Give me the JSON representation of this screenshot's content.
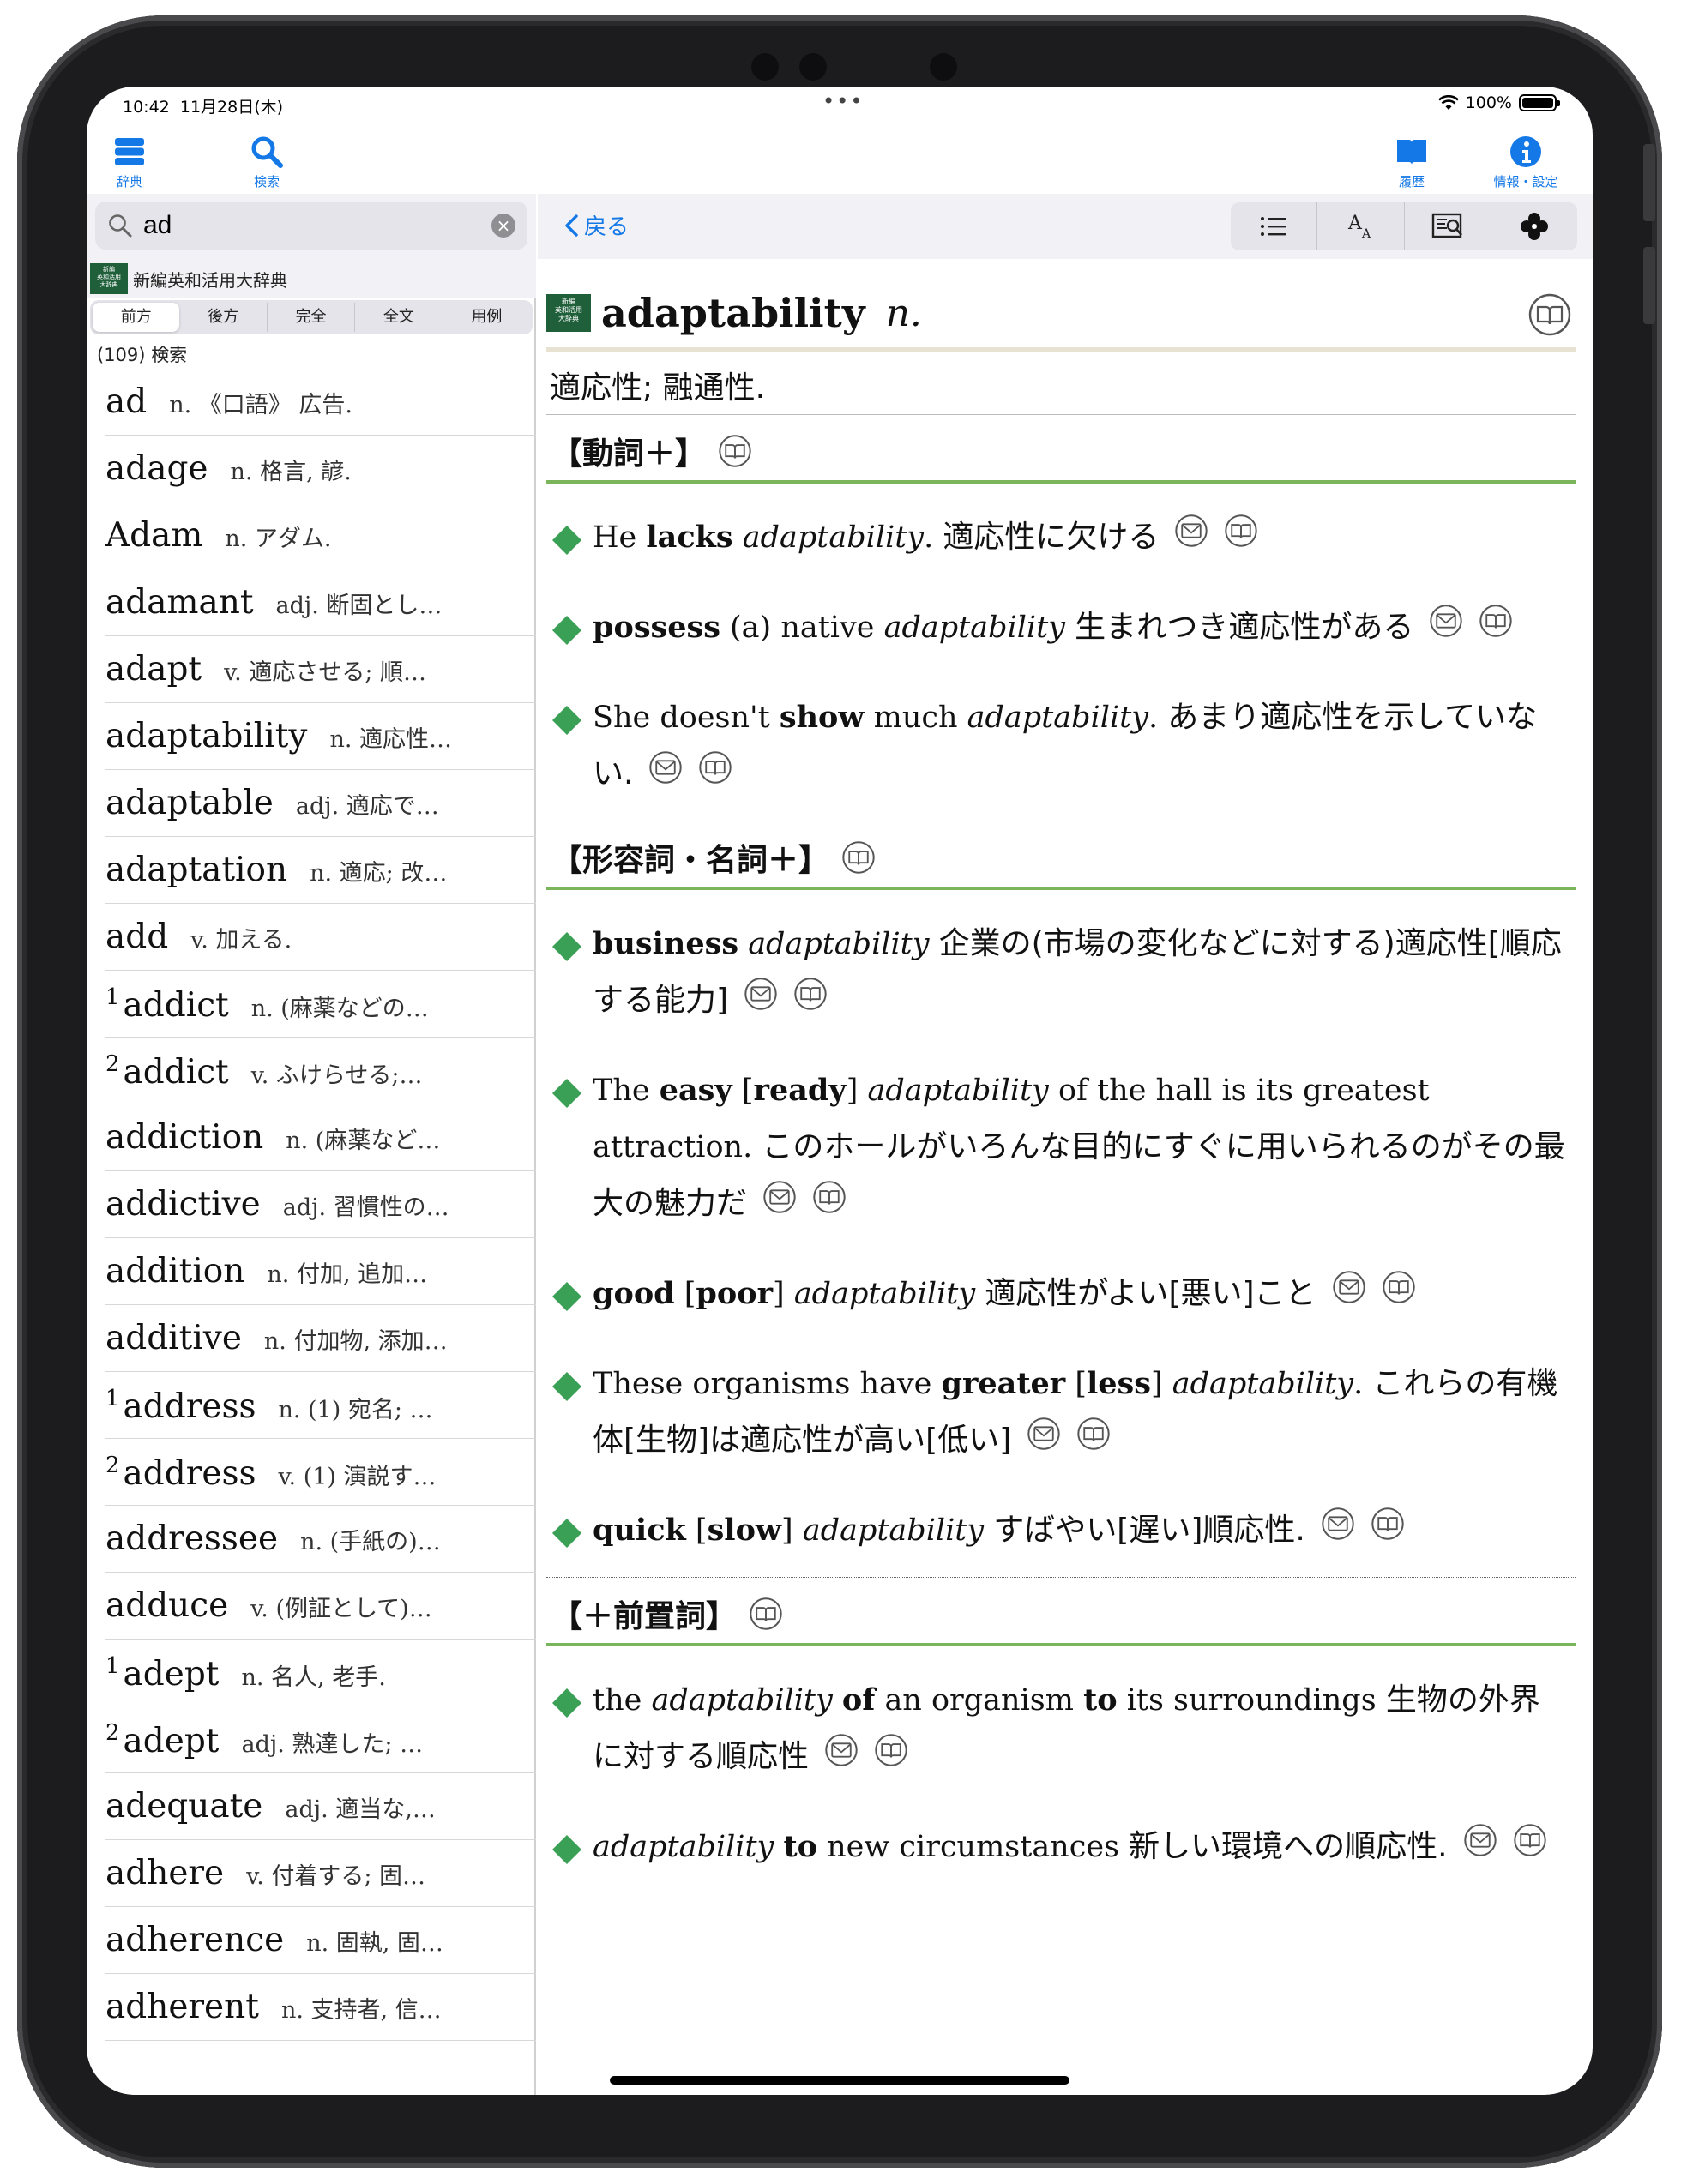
{
  "status": {
    "time": "10:42",
    "date": "11月28日(木)",
    "battery": "100%"
  },
  "toolbar": {
    "dict_label": "辞典",
    "search_label": "検索",
    "history_label": "履歴",
    "info_label": "情報・設定"
  },
  "search": {
    "value": "ad",
    "placeholder": ""
  },
  "dictionary": {
    "name": "新編英和活用大辞典",
    "logo_text": "新編英和活用大辞典"
  },
  "segments": [
    "前方",
    "後方",
    "完全",
    "全文",
    "用例"
  ],
  "selected_segment": "前方",
  "result_count": "(109) 検索",
  "list": [
    {
      "sup": "",
      "word": "ad",
      "def": "n. 《口語》 広告."
    },
    {
      "sup": "",
      "word": "adage",
      "def": "n. 格言, 諺."
    },
    {
      "sup": "",
      "word": "Adam",
      "def": "n. アダム."
    },
    {
      "sup": "",
      "word": "adamant",
      "def": "adj. 断固とし…"
    },
    {
      "sup": "",
      "word": "adapt",
      "def": "v. 適応させる; 順…"
    },
    {
      "sup": "",
      "word": "adaptability",
      "def": "n. 適応性…"
    },
    {
      "sup": "",
      "word": "adaptable",
      "def": "adj. 適応で…"
    },
    {
      "sup": "",
      "word": "adaptation",
      "def": "n. 適応; 改…"
    },
    {
      "sup": "",
      "word": "add",
      "def": "v. 加える."
    },
    {
      "sup": "1",
      "word": "addict",
      "def": "n. (麻薬などの…"
    },
    {
      "sup": "2",
      "word": "addict",
      "def": "v. ふけらせる;…"
    },
    {
      "sup": "",
      "word": "addiction",
      "def": "n. (麻薬など…"
    },
    {
      "sup": "",
      "word": "addictive",
      "def": "adj. 習慣性の…"
    },
    {
      "sup": "",
      "word": "addition",
      "def": "n. 付加, 追加…"
    },
    {
      "sup": "",
      "word": "additive",
      "def": "n. 付加物, 添加…"
    },
    {
      "sup": "1",
      "word": "address",
      "def": "n. (1) 宛名; …"
    },
    {
      "sup": "2",
      "word": "address",
      "def": "v. (1) 演説す…"
    },
    {
      "sup": "",
      "word": "addressee",
      "def": "n. (手紙の)…"
    },
    {
      "sup": "",
      "word": "adduce",
      "def": "v. (例証として)…"
    },
    {
      "sup": "1",
      "word": "adept",
      "def": "n. 名人, 老手."
    },
    {
      "sup": "2",
      "word": "adept",
      "def": "adj. 熟達した; …"
    },
    {
      "sup": "",
      "word": "adequate",
      "def": "adj. 適当な,…"
    },
    {
      "sup": "",
      "word": "adhere",
      "def": "v. 付着する; 固…"
    },
    {
      "sup": "",
      "word": "adherence",
      "def": "n. 固執, 固…"
    },
    {
      "sup": "",
      "word": "adherent",
      "def": "n. 支持者, 信…"
    }
  ],
  "nav": {
    "back_label": "戻る"
  },
  "entry": {
    "word": "adaptability",
    "pos": "n.",
    "meaning": "適応性; 融通性.",
    "sections": [
      {
        "title": "【動詞＋】",
        "examples": [
          {
            "parts": [
              [
                "n",
                "He "
              ],
              [
                "b",
                "lacks"
              ],
              [
                "n",
                " "
              ],
              [
                "i",
                "adaptability"
              ],
              [
                "n",
                ". "
              ],
              [
                "j",
                "適応性に欠ける"
              ]
            ]
          },
          {
            "parts": [
              [
                "b",
                "possess"
              ],
              [
                "n",
                " (a) native "
              ],
              [
                "i",
                "adaptability"
              ],
              [
                "n",
                " "
              ],
              [
                "j",
                "生まれつき適応性がある"
              ]
            ]
          },
          {
            "parts": [
              [
                "n",
                "She doesn't "
              ],
              [
                "b",
                "show"
              ],
              [
                "n",
                " much "
              ],
              [
                "i",
                "adaptability"
              ],
              [
                "n",
                ". "
              ],
              [
                "j",
                "あまり適応性を示していない."
              ]
            ]
          }
        ]
      },
      {
        "title": "【形容詞・名詞＋】",
        "examples": [
          {
            "parts": [
              [
                "b",
                "business"
              ],
              [
                "n",
                " "
              ],
              [
                "i",
                "adaptability"
              ],
              [
                "n",
                " "
              ],
              [
                "j",
                "企業の(市場の変化などに対する)適応性[順応する能力]"
              ]
            ]
          },
          {
            "parts": [
              [
                "n",
                "The "
              ],
              [
                "b",
                "easy"
              ],
              [
                "n",
                " ["
              ],
              [
                "b",
                "ready"
              ],
              [
                "n",
                "] "
              ],
              [
                "i",
                "adaptability"
              ],
              [
                "n",
                " of the hall is its greatest attraction. "
              ],
              [
                "j",
                "このホールがいろんな目的にすぐに用いられるのがその最大の魅力だ"
              ]
            ]
          },
          {
            "parts": [
              [
                "b",
                "good"
              ],
              [
                "n",
                " ["
              ],
              [
                "b",
                "poor"
              ],
              [
                "n",
                "] "
              ],
              [
                "i",
                "adaptability"
              ],
              [
                "n",
                " "
              ],
              [
                "j",
                "適応性がよい[悪い]こと"
              ]
            ]
          },
          {
            "parts": [
              [
                "n",
                "These organisms have "
              ],
              [
                "b",
                "greater"
              ],
              [
                "n",
                " ["
              ],
              [
                "b",
                "less"
              ],
              [
                "n",
                "] "
              ],
              [
                "i",
                "adaptability"
              ],
              [
                "n",
                ". "
              ],
              [
                "j",
                "これらの有機体[生物]は適応性が高い[低い]"
              ]
            ]
          },
          {
            "parts": [
              [
                "b",
                "quick"
              ],
              [
                "n",
                " ["
              ],
              [
                "b",
                "slow"
              ],
              [
                "n",
                "] "
              ],
              [
                "i",
                "adaptability"
              ],
              [
                "n",
                " "
              ],
              [
                "j",
                "すばやい[遅い]順応性."
              ]
            ]
          }
        ]
      },
      {
        "title": "【＋前置詞】",
        "examples": [
          {
            "parts": [
              [
                "n",
                "the "
              ],
              [
                "i",
                "adaptability"
              ],
              [
                "n",
                " "
              ],
              [
                "b",
                "of"
              ],
              [
                "n",
                " an organism "
              ],
              [
                "b",
                "to"
              ],
              [
                "n",
                " its surroundings "
              ],
              [
                "j",
                "生物の外界に対する順応性"
              ]
            ]
          },
          {
            "parts": [
              [
                "i",
                "adaptability"
              ],
              [
                "n",
                " "
              ],
              [
                "b",
                "to"
              ],
              [
                "n",
                " new circumstances "
              ],
              [
                "j",
                "新しい環境への順応性."
              ]
            ]
          }
        ]
      }
    ]
  },
  "colors": {
    "accent": "#1478e6",
    "section_rule": "#7ab55c",
    "diamond": "#3aa055",
    "dict_logo": "#1f5f3a"
  },
  "icons": [
    "wifi-icon",
    "battery-icon",
    "dictionary-icon",
    "search-icon",
    "history-icon",
    "info-icon",
    "list-icon",
    "font-size-icon",
    "text-search-icon",
    "clover-icon",
    "book-icon",
    "mail-icon",
    "diamond-icon",
    "clear-icon",
    "chevron-left-icon"
  ]
}
